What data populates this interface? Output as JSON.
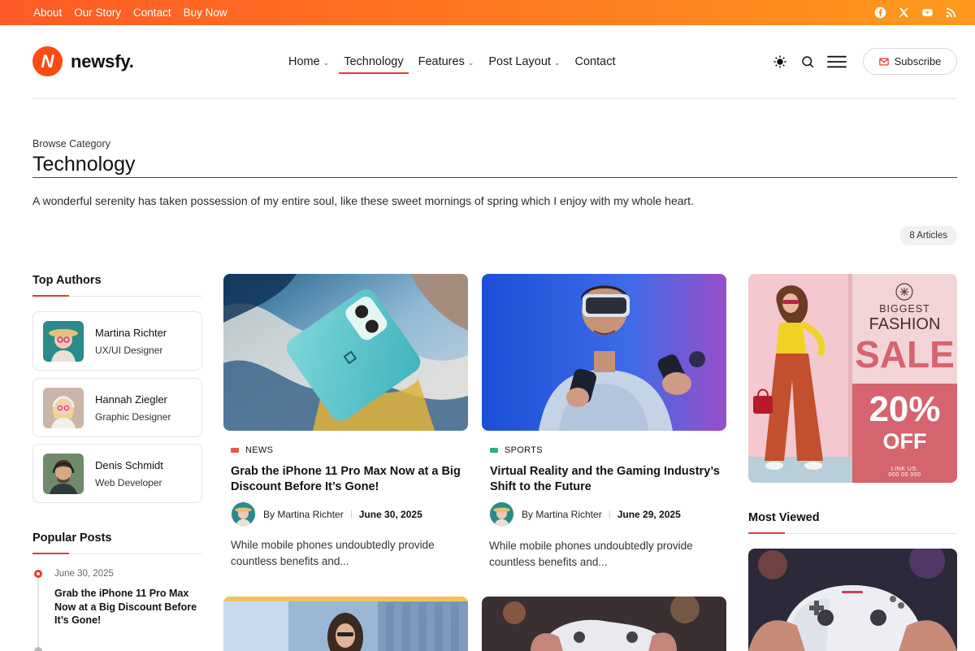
{
  "topbar": {
    "links": [
      "About",
      "Our Story",
      "Contact",
      "Buy Now"
    ],
    "socials": [
      "facebook-icon",
      "x-icon",
      "youtube-icon",
      "rss-icon"
    ]
  },
  "brand": {
    "name": "newsfy.",
    "mark": "N",
    "accent": "#e63b2e"
  },
  "nav": {
    "items": [
      {
        "label": "Home",
        "dropdown": true
      },
      {
        "label": "Technology",
        "dropdown": false,
        "active": true
      },
      {
        "label": "Features",
        "dropdown": true
      },
      {
        "label": "Post Layout",
        "dropdown": true
      },
      {
        "label": "Contact",
        "dropdown": false
      }
    ],
    "subscribe_label": "Subscribe"
  },
  "category": {
    "eyebrow": "Browse Category",
    "title": "Technology",
    "description": "A wonderful serenity has taken possession of my entire soul, like these sweet mornings of spring which I enjoy with my whole heart.",
    "count": "8 Articles"
  },
  "sidebar": {
    "authors_heading": "Top Authors",
    "authors": [
      {
        "name": "Martina Richter",
        "role": "UX/UI Designer"
      },
      {
        "name": "Hannah Ziegler",
        "role": "Graphic Designer"
      },
      {
        "name": "Denis Schmidt",
        "role": "Web Developer"
      }
    ],
    "popular_heading": "Popular Posts",
    "popular": [
      {
        "date": "June 30, 2025",
        "title": "Grab the iPhone 11 Pro Max Now at a Big Discount Before It’s Gone!"
      }
    ]
  },
  "posts": [
    {
      "tag": "NEWS",
      "tag_color": "#e8554a",
      "title": "Grab the iPhone 11 Pro Max Now at a Big Discount Before It’s Gone!",
      "author": "By Martina Richter",
      "date": "June 30, 2025",
      "excerpt": "While mobile phones undoubtedly provide countless benefits and..."
    },
    {
      "tag": "SPORTS",
      "tag_color": "#2fb07a",
      "title": "Virtual Reality and the Gaming Industry’s Shift to the Future",
      "author": "By Martina Richter",
      "date": "June 29, 2025",
      "excerpt": "While mobile phones undoubtedly provide countless benefits and..."
    }
  ],
  "ad": {
    "line1": "BIGGEST",
    "line2": "FASHION",
    "line3": "SALE",
    "percent": "20%",
    "off": "OFF",
    "link_label": "LINK US:",
    "phone": "000 00 000"
  },
  "most_viewed": {
    "heading": "Most Viewed"
  }
}
